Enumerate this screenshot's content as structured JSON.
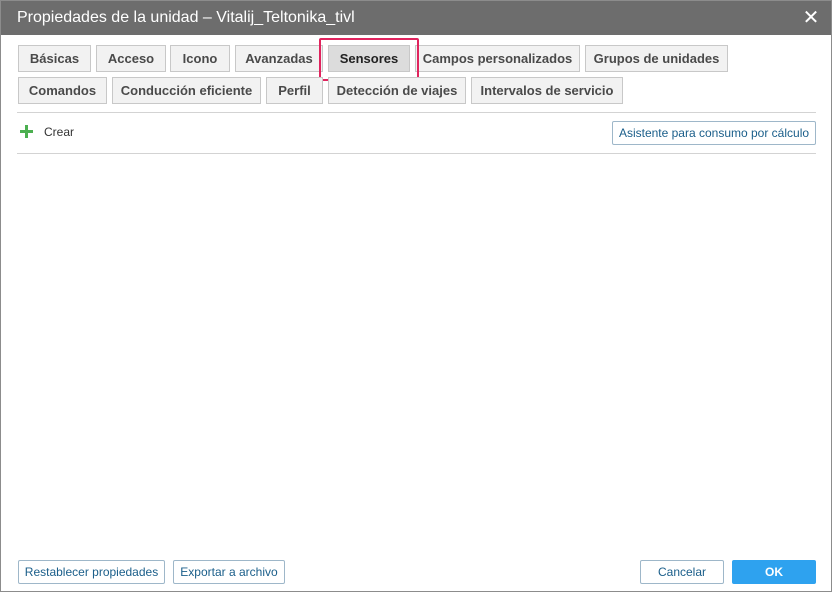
{
  "dialog": {
    "title": "Propiedades de la unidad – Vitalij_Teltonika_tivl",
    "close_symbol": "✕"
  },
  "tabs_row1": [
    {
      "label": "Básicas"
    },
    {
      "label": "Acceso"
    },
    {
      "label": "Icono"
    },
    {
      "label": "Avanzadas"
    },
    {
      "label": "Sensores",
      "active": true
    },
    {
      "label": "Campos personalizados"
    },
    {
      "label": "Grupos de unidades"
    }
  ],
  "tabs_row2": [
    {
      "label": "Comandos"
    },
    {
      "label": "Conducción eficiente"
    },
    {
      "label": "Perfil"
    },
    {
      "label": "Detección de viajes"
    },
    {
      "label": "Intervalos de servicio"
    }
  ],
  "toolbar": {
    "create_label": "Crear",
    "wizard_label": "Asistente para consumo por cálculo"
  },
  "footer": {
    "reset_label": "Restablecer propiedades",
    "export_label": "Exportar a archivo",
    "cancel_label": "Cancelar",
    "ok_label": "OK"
  }
}
